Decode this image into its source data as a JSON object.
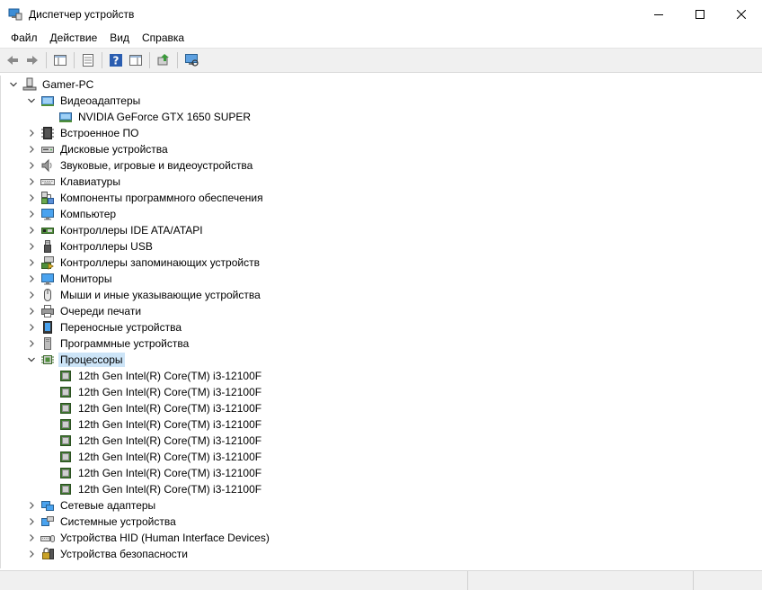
{
  "window": {
    "title": "Диспетчер устройств"
  },
  "menu": [
    "Файл",
    "Действие",
    "Вид",
    "Справка"
  ],
  "toolbar": [
    "back-icon",
    "forward-icon",
    "sep",
    "show-hide-console-tree-icon",
    "sep",
    "properties-icon",
    "sep",
    "help-icon",
    "action-pane-icon",
    "sep",
    "update-driver-icon",
    "sep",
    "scan-hardware-icon"
  ],
  "tree": {
    "root": "Gamer-PC",
    "categories": [
      {
        "label": "Видеоадаптеры",
        "icon": "display-adapter-icon",
        "expanded": true,
        "children": [
          "NVIDIA GeForce GTX 1650 SUPER"
        ]
      },
      {
        "label": "Встроенное ПО",
        "icon": "firmware-icon",
        "expanded": false
      },
      {
        "label": "Дисковые устройства",
        "icon": "disk-drive-icon",
        "expanded": false
      },
      {
        "label": "Звуковые, игровые и видеоустройства",
        "icon": "speaker-icon",
        "expanded": false
      },
      {
        "label": "Клавиатуры",
        "icon": "keyboard-icon",
        "expanded": false
      },
      {
        "label": "Компоненты программного обеспечения",
        "icon": "software-component-icon",
        "expanded": false
      },
      {
        "label": "Компьютер",
        "icon": "computer-icon",
        "expanded": false
      },
      {
        "label": "Контроллеры IDE ATA/ATAPI",
        "icon": "ide-controller-icon",
        "expanded": false
      },
      {
        "label": "Контроллеры USB",
        "icon": "usb-icon",
        "expanded": false
      },
      {
        "label": "Контроллеры запоминающих устройств",
        "icon": "storage-controller-icon",
        "expanded": false
      },
      {
        "label": "Мониторы",
        "icon": "monitor-icon",
        "expanded": false
      },
      {
        "label": "Мыши и иные указывающие устройства",
        "icon": "mouse-icon",
        "expanded": false
      },
      {
        "label": "Очереди печати",
        "icon": "printer-icon",
        "expanded": false
      },
      {
        "label": "Переносные устройства",
        "icon": "portable-device-icon",
        "expanded": false
      },
      {
        "label": "Программные устройства",
        "icon": "software-device-icon",
        "expanded": false
      },
      {
        "label": "Процессоры",
        "icon": "processor-icon",
        "expanded": true,
        "selected": true,
        "children": [
          "12th Gen Intel(R) Core(TM) i3-12100F",
          "12th Gen Intel(R) Core(TM) i3-12100F",
          "12th Gen Intel(R) Core(TM) i3-12100F",
          "12th Gen Intel(R) Core(TM) i3-12100F",
          "12th Gen Intel(R) Core(TM) i3-12100F",
          "12th Gen Intel(R) Core(TM) i3-12100F",
          "12th Gen Intel(R) Core(TM) i3-12100F",
          "12th Gen Intel(R) Core(TM) i3-12100F"
        ]
      },
      {
        "label": "Сетевые адаптеры",
        "icon": "network-adapter-icon",
        "expanded": false
      },
      {
        "label": "Системные устройства",
        "icon": "system-device-icon",
        "expanded": false
      },
      {
        "label": "Устройства HID (Human Interface Devices)",
        "icon": "hid-icon",
        "expanded": false
      },
      {
        "label": "Устройства безопасности",
        "icon": "security-device-icon",
        "expanded": false
      }
    ]
  },
  "colors": {
    "selection": "#cce4f7",
    "accent": "#0a64ad"
  }
}
